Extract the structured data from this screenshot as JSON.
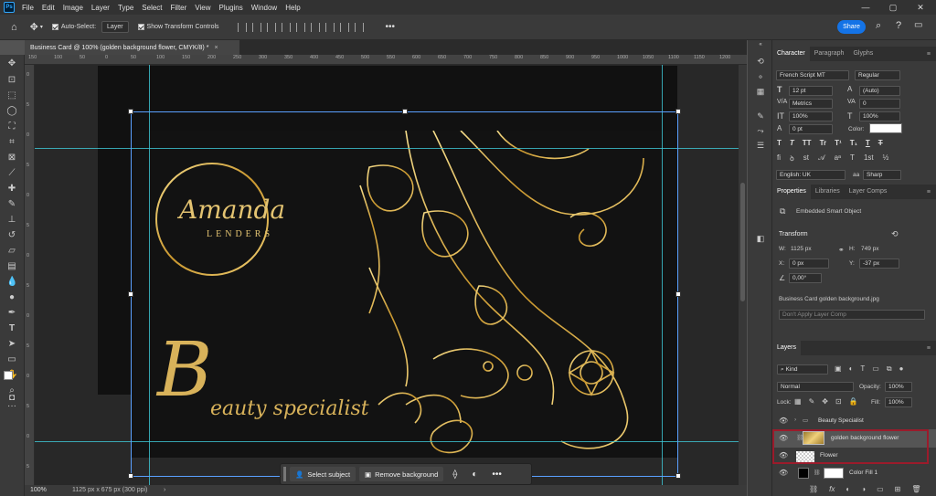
{
  "app": {
    "logo": "Ps"
  },
  "menubar": {
    "items": [
      "File",
      "Edit",
      "Image",
      "Layer",
      "Type",
      "Select",
      "Filter",
      "View",
      "Plugins",
      "Window",
      "Help"
    ]
  },
  "options": {
    "auto_select_label": "Auto-Select:",
    "auto_select_value": "Layer",
    "show_transform_label": "Show Transform Controls",
    "more": "•••",
    "share": "Share"
  },
  "document": {
    "tab_title": "Business Card @ 100% (golden background flower, CMYK/8) *",
    "zoom": "100%",
    "doc_info": "1125 px x 675 px (300 ppi)"
  },
  "ruler": {
    "h_ticks": [
      "150",
      "100",
      "50",
      "0",
      "50",
      "100",
      "150",
      "200",
      "250",
      "300",
      "350",
      "400",
      "450",
      "500",
      "550",
      "600",
      "650",
      "700",
      "750",
      "800",
      "850",
      "900",
      "950",
      "1000",
      "1050",
      "1100",
      "1150",
      "1200"
    ],
    "v_ticks": [
      "0",
      "5",
      "0",
      "5",
      "0",
      "5",
      "0",
      "5",
      "0",
      "5",
      "0",
      "5",
      "0",
      "5"
    ]
  },
  "card": {
    "name_script": "Amanda",
    "name_caps": "LENDERS",
    "big_letter": "B",
    "tagline": "eauty specialist"
  },
  "context_bar": {
    "select_subject": "Select subject",
    "remove_background": "Remove background",
    "more": "•••"
  },
  "character": {
    "tabs": [
      "Character",
      "Paragraph",
      "Glyphs"
    ],
    "font_family": "French Script MT",
    "font_style": "Regular",
    "size": "12 pt",
    "leading": "(Auto)",
    "kerning": "Metrics",
    "tracking": "0",
    "vscale": "100%",
    "hscale": "100%",
    "baseline": "0 pt",
    "color_label": "Color:",
    "type_styles": [
      "T",
      "T",
      "TT",
      "Tr",
      "T¹",
      "T₁",
      "T",
      "T"
    ],
    "language": "English: UK",
    "aa_symbol": "aa",
    "antialias": "Sharp"
  },
  "properties": {
    "tabs": [
      "Properties",
      "Libraries",
      "Layer Comps"
    ],
    "type": "Embedded Smart Object",
    "transform_title": "Transform",
    "w_label": "W:",
    "w": "1125 px",
    "h_label": "H:",
    "h": "749 px",
    "x_label": "X:",
    "x": "0 px",
    "y_label": "Y:",
    "y": "-37 px",
    "angle": "0,00°",
    "source_file": "Business Card golden background.jpg",
    "layer_comp": "Don't Apply Layer Comp"
  },
  "layers": {
    "tab": "Layers",
    "filter": "Kind",
    "blend": "Normal",
    "opacity_label": "Opacity:",
    "opacity": "100%",
    "lock_label": "Lock:",
    "fill_label": "Fill:",
    "fill": "100%",
    "items": [
      {
        "name": "Beauty Specialist",
        "kind": "group"
      },
      {
        "name": "golden background flower",
        "kind": "smart"
      },
      {
        "name": "Flower",
        "kind": "layer"
      },
      {
        "name": "Color Fill 1",
        "kind": "fill"
      }
    ],
    "footer": [
      "⛓",
      "fx",
      "◐",
      "◑",
      "▭",
      "⊞",
      "🗑"
    ]
  },
  "colors": {
    "gold": "#d8b25a",
    "accent_blue": "#1473e6",
    "guide": "#3ec9d8",
    "highlight": "#9b1b2b"
  }
}
